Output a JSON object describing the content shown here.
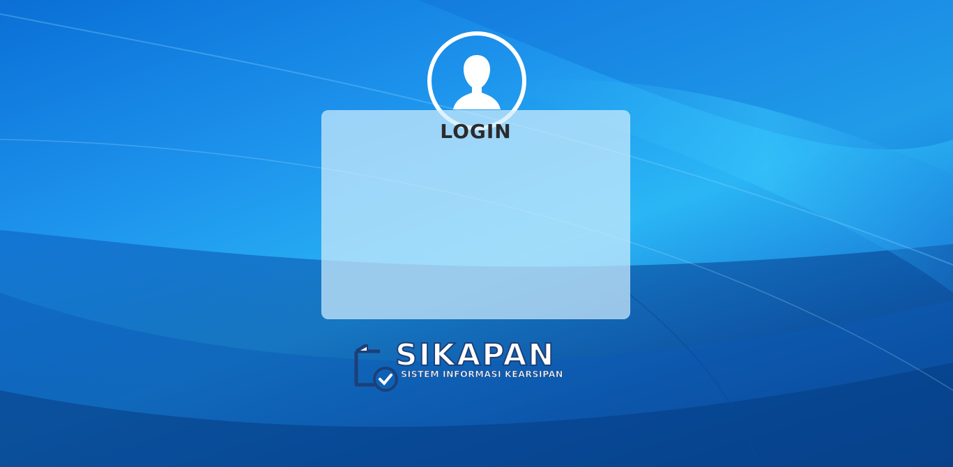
{
  "login": {
    "title": "LOGIN"
  },
  "avatar": {
    "icon": "user-icon"
  },
  "brand": {
    "name": "SIKAPAN",
    "subtitle": "SISTEM INFORMASI KEARSIPAN",
    "icon": "document-check-icon"
  },
  "colors": {
    "background": "#1d93ec",
    "card": "#cdebfc",
    "title_text": "#2b2b2b",
    "logo_outline": "#1d3f78"
  }
}
